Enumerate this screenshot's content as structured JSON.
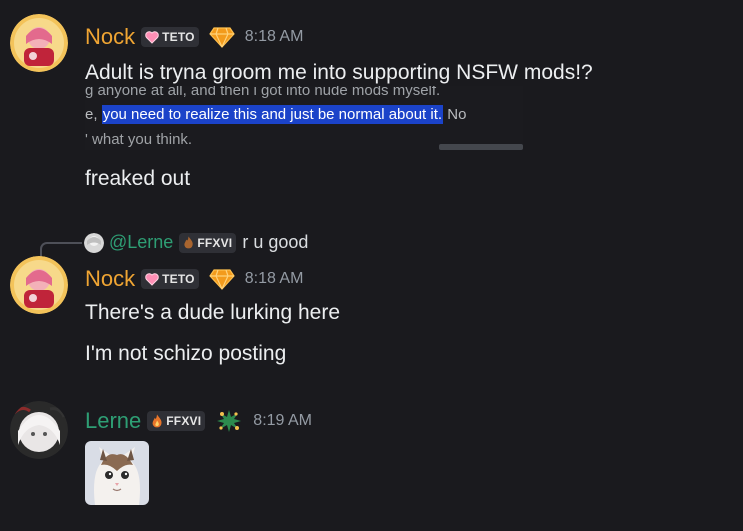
{
  "messages": {
    "m1": {
      "username": "Nock",
      "tag": "TETO",
      "time": "8:18 AM",
      "text1": "Adult is tryna groom me into supporting NSFW mods!?",
      "screenshot": {
        "line1": "g anyone at all, and then i got into nude mods myself.",
        "line2_prefix": "e, ",
        "line2_highlight": "you need to realize this and just be normal about it.",
        "line2_suffix": " No",
        "line3": "' what you think."
      },
      "text2": "freaked out"
    },
    "reply": {
      "username": "@Lerne",
      "tag": "FFXVI",
      "text": "r u good"
    },
    "m2": {
      "username": "Nock",
      "tag": "TETO",
      "time": "8:18 AM",
      "text1": "There's a dude lurking here",
      "text2": "I'm not schizo posting"
    },
    "m3": {
      "username": "Lerne",
      "tag": "FFXVI",
      "time": "8:19 AM"
    }
  },
  "icons": {
    "heart": "heart-icon",
    "diamond": "diamond-icon",
    "flame": "flame-icon",
    "plant": "plant-icon"
  },
  "colors": {
    "nock": "#f0a533",
    "lerne": "#2e9e74",
    "highlight": "#1b43c9",
    "background": "#1a1a1e"
  }
}
